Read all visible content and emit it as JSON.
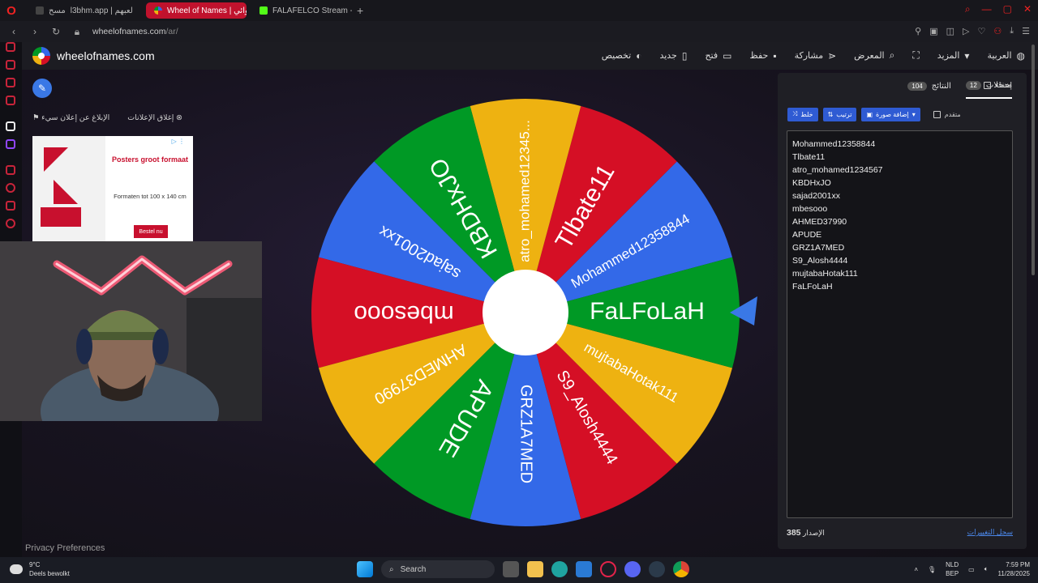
{
  "browser": {
    "tabs": [
      {
        "label": "l3bhm.app | لعبهم",
        "prefix": "مسح"
      },
      {
        "label": "Wheel of Names | عشوائي",
        "active": true
      },
      {
        "label": "FALAFELCO Stream - Wat"
      }
    ],
    "url_host": "wheelofnames.com",
    "url_path": "/ar/"
  },
  "site": {
    "title": "wheelofnames.com",
    "menu": {
      "language": "العربية",
      "more": "المزيد",
      "gallery": "المعرض",
      "share": "مشاركة",
      "save": "حفظ",
      "open": "فتح",
      "new": "جديد",
      "customize": "تخصيص"
    }
  },
  "ads": {
    "close_ads": "إغلاق الإعلانات",
    "report_ad": "الإبلاغ عن إعلان سيء",
    "ad_title": "Posters groot formaat",
    "ad_sub": "Formaten tot 100 x 140 cm",
    "ad_button": "Bestel nu"
  },
  "wheel": {
    "segments": [
      {
        "label": "Mohammed12358844",
        "color": "#3369e8"
      },
      {
        "label": "Tlbate11",
        "color": "#d50f25"
      },
      {
        "label": "atro_mohamed12345...",
        "color": "#eeb211"
      },
      {
        "label": "KBDHxJO",
        "color": "#009925"
      },
      {
        "label": "sajad2001xx",
        "color": "#3369e8"
      },
      {
        "label": "mbesooo",
        "color": "#d50f25"
      },
      {
        "label": "AHMED37990",
        "color": "#eeb211"
      },
      {
        "label": "APUDE",
        "color": "#009925"
      },
      {
        "label": "GRZ1A7MED",
        "color": "#3369e8"
      },
      {
        "label": "S9_Alosh4444",
        "color": "#d50f25"
      },
      {
        "label": "mujtabaHotak111",
        "color": "#eeb211"
      },
      {
        "label": "FaLFoLaH",
        "color": "#009925"
      }
    ],
    "pointer_color": "#3a78e6"
  },
  "panel": {
    "tab_entries": "مدخلات",
    "entries_count": "12",
    "tab_results": "النتائج",
    "results_count": "104",
    "hide_label": "إخفاء",
    "shuffle": "خلط",
    "sort": "ترتيب",
    "add_image": "إضافة صورة",
    "advanced": "متقدم",
    "entries": [
      "Mohammed12358844",
      "Tlbate11",
      "atro_mohamed1234567",
      "KBDHxJO",
      "sajad2001xx",
      "mbesooo",
      "AHMED37990",
      "APUDE",
      "GRZ1A7MED",
      "S9_Alosh4444",
      "mujtabaHotak111",
      "FaLFoLaH"
    ],
    "version_label": "الإصدار",
    "version_number": "385",
    "changelog": "سجل التغييرات"
  },
  "privacy": "Privacy Preferences",
  "taskbar": {
    "temp": "9°C",
    "weather": "Deels bewolkt",
    "search": "Search",
    "lang_top": "NLD",
    "lang_bottom": "BEP",
    "time": "7:59 PM",
    "date": "11/28/2025"
  }
}
